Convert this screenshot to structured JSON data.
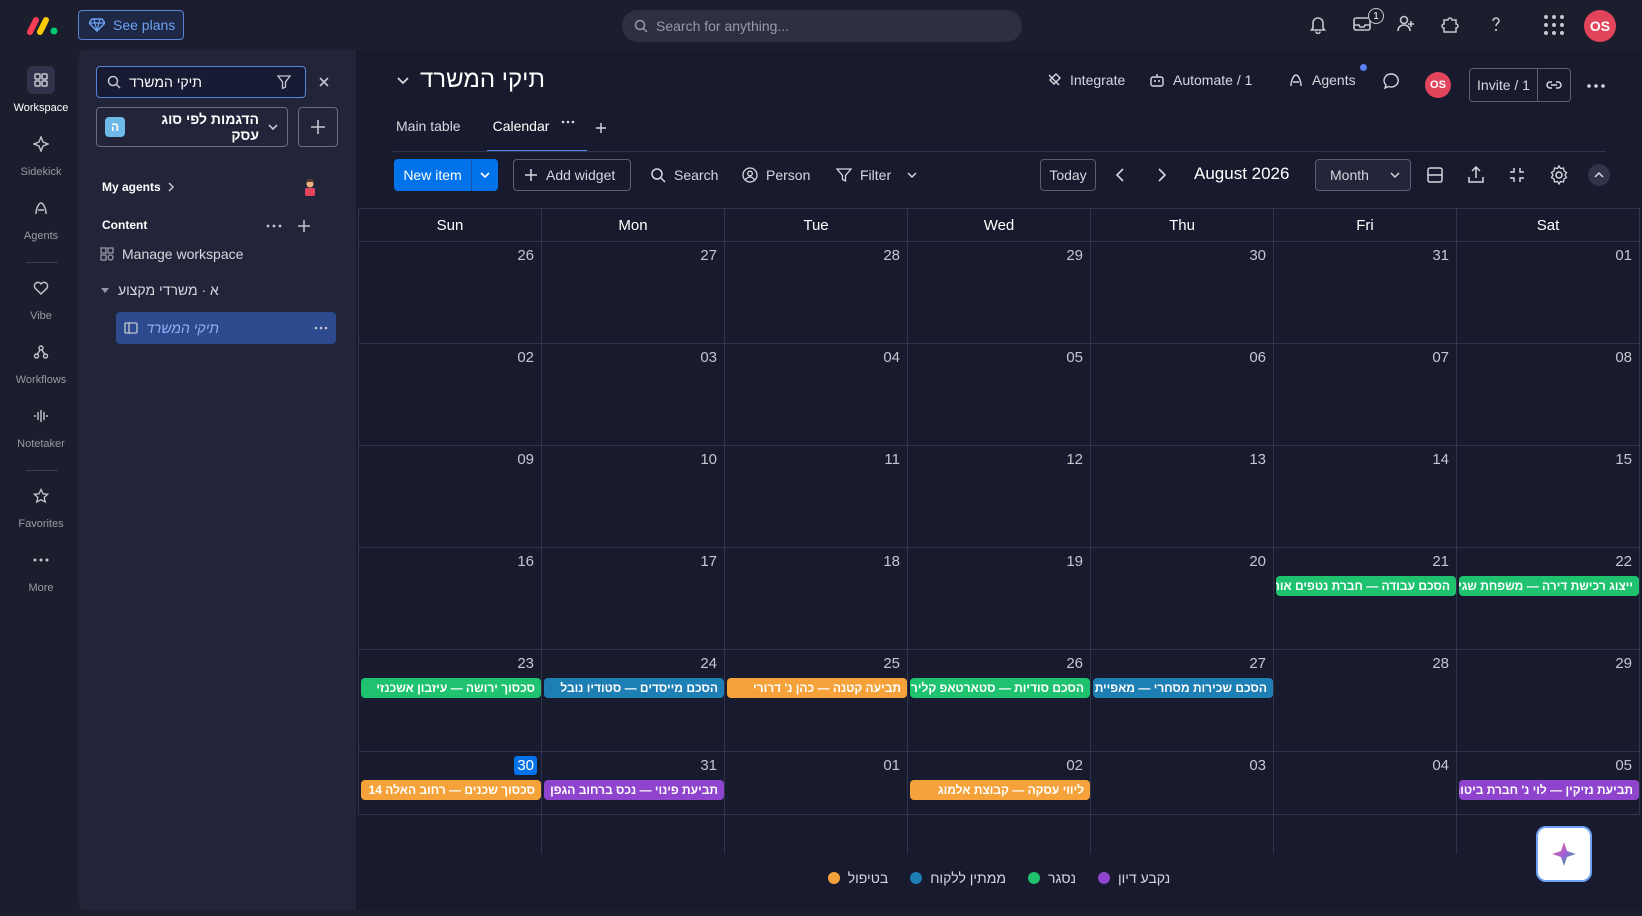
{
  "topbar": {
    "see_plans": "See plans",
    "search_placeholder": "Search for anything...",
    "inbox_badge": "1",
    "user_initials": "OS"
  },
  "rail": {
    "items": [
      {
        "label": "Workspace",
        "icon": "grid-icon"
      },
      {
        "label": "Sidekick",
        "icon": "sparkle-icon"
      },
      {
        "label": "Agents",
        "icon": "agent-icon"
      },
      {
        "label": "Vibe",
        "icon": "heart-icon"
      },
      {
        "label": "Workflows",
        "icon": "workflow-icon"
      },
      {
        "label": "Notetaker",
        "icon": "waveform-icon"
      },
      {
        "label": "Favorites",
        "icon": "star-icon"
      },
      {
        "label": "More",
        "icon": "more-icon"
      }
    ]
  },
  "workspace": {
    "search_value": "תיקי המשרד",
    "selector_badge": "ה",
    "selector_name": "הדגמות לפי סוג עסק",
    "my_agents": "My agents",
    "content": "Content",
    "manage": "Manage workspace",
    "folder": "א · משרדי מקצוע",
    "board": "תיקי המשרד"
  },
  "board": {
    "title": "תיקי המשרד",
    "integrate": "Integrate",
    "automate": "Automate / 1",
    "agents": "Agents",
    "avatar": "OS",
    "invite": "Invite / 1",
    "tabs": [
      "Main table",
      "Calendar"
    ]
  },
  "toolbar": {
    "new_item": "New item",
    "add_widget": "Add widget",
    "search": "Search",
    "person": "Person",
    "filter": "Filter",
    "today": "Today",
    "month_label": "August 2026",
    "view": "Month"
  },
  "calendar": {
    "days_of_week": [
      "Sun",
      "Mon",
      "Tue",
      "Wed",
      "Thu",
      "Fri",
      "Sat"
    ],
    "weeks": [
      [
        "26",
        "27",
        "28",
        "29",
        "30",
        "31",
        "01"
      ],
      [
        "02",
        "03",
        "04",
        "05",
        "06",
        "07",
        "08"
      ],
      [
        "09",
        "10",
        "11",
        "12",
        "13",
        "14",
        "15"
      ],
      [
        "16",
        "17",
        "18",
        "19",
        "20",
        "21",
        "22"
      ],
      [
        "23",
        "24",
        "25",
        "26",
        "27",
        "28",
        "29"
      ],
      [
        "30",
        "31",
        "01",
        "02",
        "03",
        "04",
        "05"
      ]
    ],
    "today": "30",
    "events": {
      "w3d5": {
        "text": "הסכם עבודה — חברת נטפים אור",
        "color": "green"
      },
      "w3d6": {
        "text": "ייצוג רכישת דירה — משפחת שגיא",
        "color": "green"
      },
      "w4d0": {
        "text": "סכסוך ירושה — עיזבון אשכנזי",
        "color": "green"
      },
      "w4d1": {
        "text": "הסכם מייסדים — סטודיו נובל",
        "color": "teal"
      },
      "w4d2": {
        "text": "תביעה קטנה — כהן נ' דרורי",
        "color": "orange"
      },
      "w4d3": {
        "text": "הסכם סודיות — סטארטאפ קליר",
        "color": "green"
      },
      "w4d4": {
        "text": "הסכם שכירות מסחרי — מאפיית לוי",
        "color": "teal"
      },
      "w5d0": {
        "text": "סכסוך שכנים — רחוב האלה 14",
        "color": "orange"
      },
      "w5d1": {
        "text": "תביעת פינוי — נכס ברחוב הגפן",
        "color": "purple"
      },
      "w5d3": {
        "text": "ליווי עסקה — קבוצת אלמוג",
        "color": "orange"
      },
      "w5d6": {
        "text": "תביעת נזיקין — לוי נ' חברת ביטוח",
        "color": "purple"
      }
    }
  },
  "legend": [
    {
      "label": "בטיפול",
      "color": "#f5a23b"
    },
    {
      "label": "ממתין ללקוח",
      "color": "#1e7fb5"
    },
    {
      "label": "נסגר",
      "color": "#1fc26e"
    },
    {
      "label": "נקבע דיון",
      "color": "#8e44cc"
    }
  ]
}
